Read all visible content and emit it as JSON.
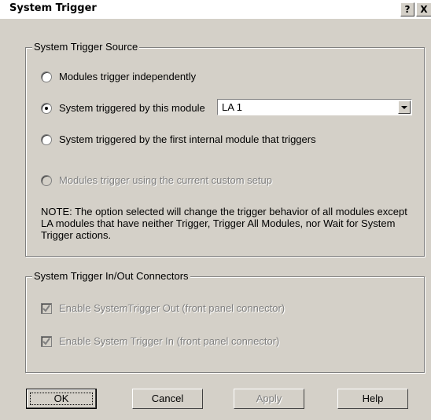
{
  "window": {
    "title": "System Trigger",
    "help_glyph": "?",
    "close_glyph": "X"
  },
  "source_group": {
    "legend": "System Trigger Source",
    "options": [
      {
        "label": "Modules trigger independently",
        "checked": false,
        "enabled": true
      },
      {
        "label": "System triggered by this module",
        "checked": true,
        "enabled": true
      },
      {
        "label": "System triggered by the first internal module that triggers",
        "checked": false,
        "enabled": true
      },
      {
        "label": "Modules trigger using the current custom setup",
        "checked": false,
        "enabled": false
      }
    ],
    "module_select": {
      "value": "LA 1"
    },
    "note": "NOTE: The option selected will change the trigger behavior of all modules except LA modules that have neither Trigger, Trigger All Modules, nor Wait for System Trigger actions."
  },
  "connector_group": {
    "legend": "System Trigger In/Out Connectors",
    "options": [
      {
        "label": "Enable SystemTrigger Out (front panel connector)",
        "checked": true,
        "enabled": false
      },
      {
        "label": "Enable System Trigger In (front panel connector)",
        "checked": true,
        "enabled": false
      }
    ]
  },
  "buttons": {
    "ok": "OK",
    "cancel": "Cancel",
    "apply": "Apply",
    "help": "Help"
  },
  "colors": {
    "face": "#d4d0c8",
    "shadow": "#808080",
    "disabled_text": "#808080"
  }
}
